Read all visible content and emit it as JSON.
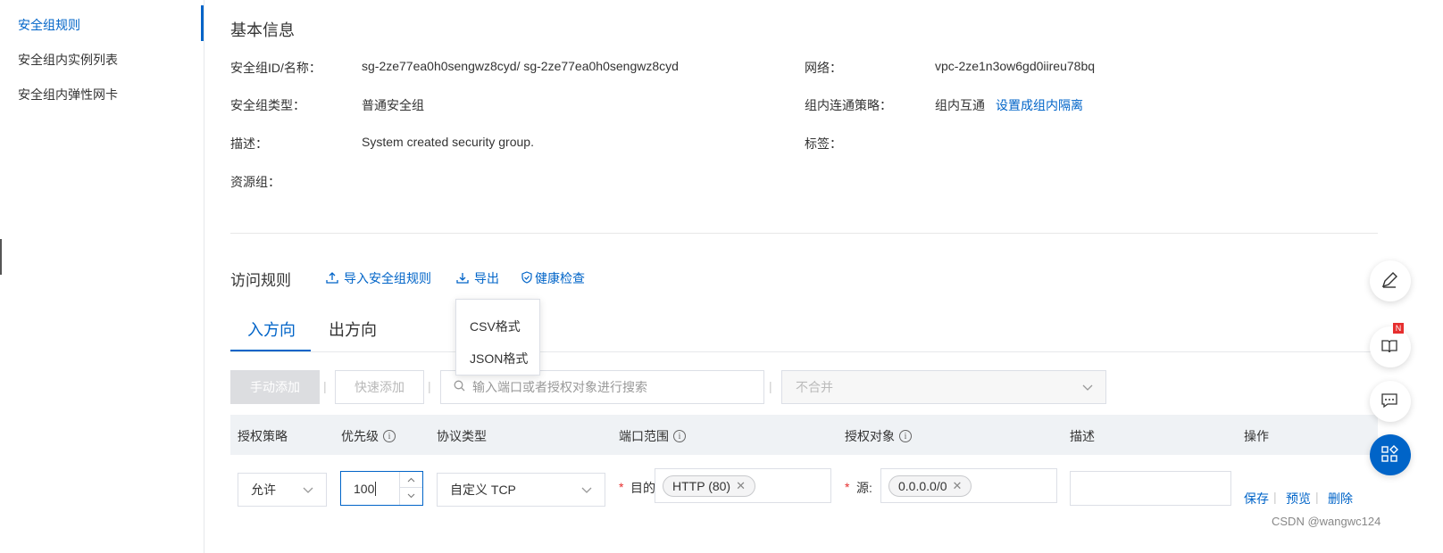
{
  "sidebar": {
    "items": [
      {
        "label": "安全组规则",
        "active": true
      },
      {
        "label": "安全组内实例列表",
        "active": false
      },
      {
        "label": "安全组内弹性网卡",
        "active": false
      }
    ]
  },
  "basic_info": {
    "title": "基本信息",
    "sg_id_label": "安全组ID/名称：",
    "sg_id_value": "sg-2ze77ea0h0sengwz8cyd/ sg-2ze77ea0h0sengwz8cyd",
    "network_label": "网络：",
    "network_value": "vpc-2ze1n3ow6gd0iireu78bq",
    "type_label": "安全组类型：",
    "type_value": "普通安全组",
    "policy_label": "组内连通策略：",
    "policy_value": "组内互通",
    "policy_link": "设置成组内隔离",
    "desc_label": "描述：",
    "desc_value": "System created security group.",
    "tags_label": "标签：",
    "resource_group_label": "资源组："
  },
  "rules": {
    "title": "访问规则",
    "import_label": "导入安全组规则",
    "export_label": "导出",
    "health_label": "健康检查",
    "export_menu": [
      "CSV格式",
      "JSON格式"
    ],
    "tabs": [
      {
        "label": "入方向",
        "active": true
      },
      {
        "label": "出方向",
        "active": false
      }
    ],
    "manual_add": "手动添加",
    "quick_add": "快速添加",
    "search_placeholder": "输入端口或者授权对象进行搜索",
    "merge_select": "不合并",
    "columns": [
      "授权策略",
      "优先级",
      "协议类型",
      "端口范围",
      "授权对象",
      "描述",
      "操作"
    ],
    "row": {
      "policy": "允许",
      "priority": "100",
      "protocol": "自定义 TCP",
      "port_label": "目的",
      "port_tag": "HTTP (80)",
      "source_label": "源:",
      "source_tag": "0.0.0.0/0",
      "actions": [
        "保存",
        "预览",
        "删除"
      ]
    }
  },
  "float_badge": "N",
  "watermark": "CSDN @wangwc124",
  "colors": {
    "accent": "#0064c8",
    "danger": "#e62e2e"
  }
}
